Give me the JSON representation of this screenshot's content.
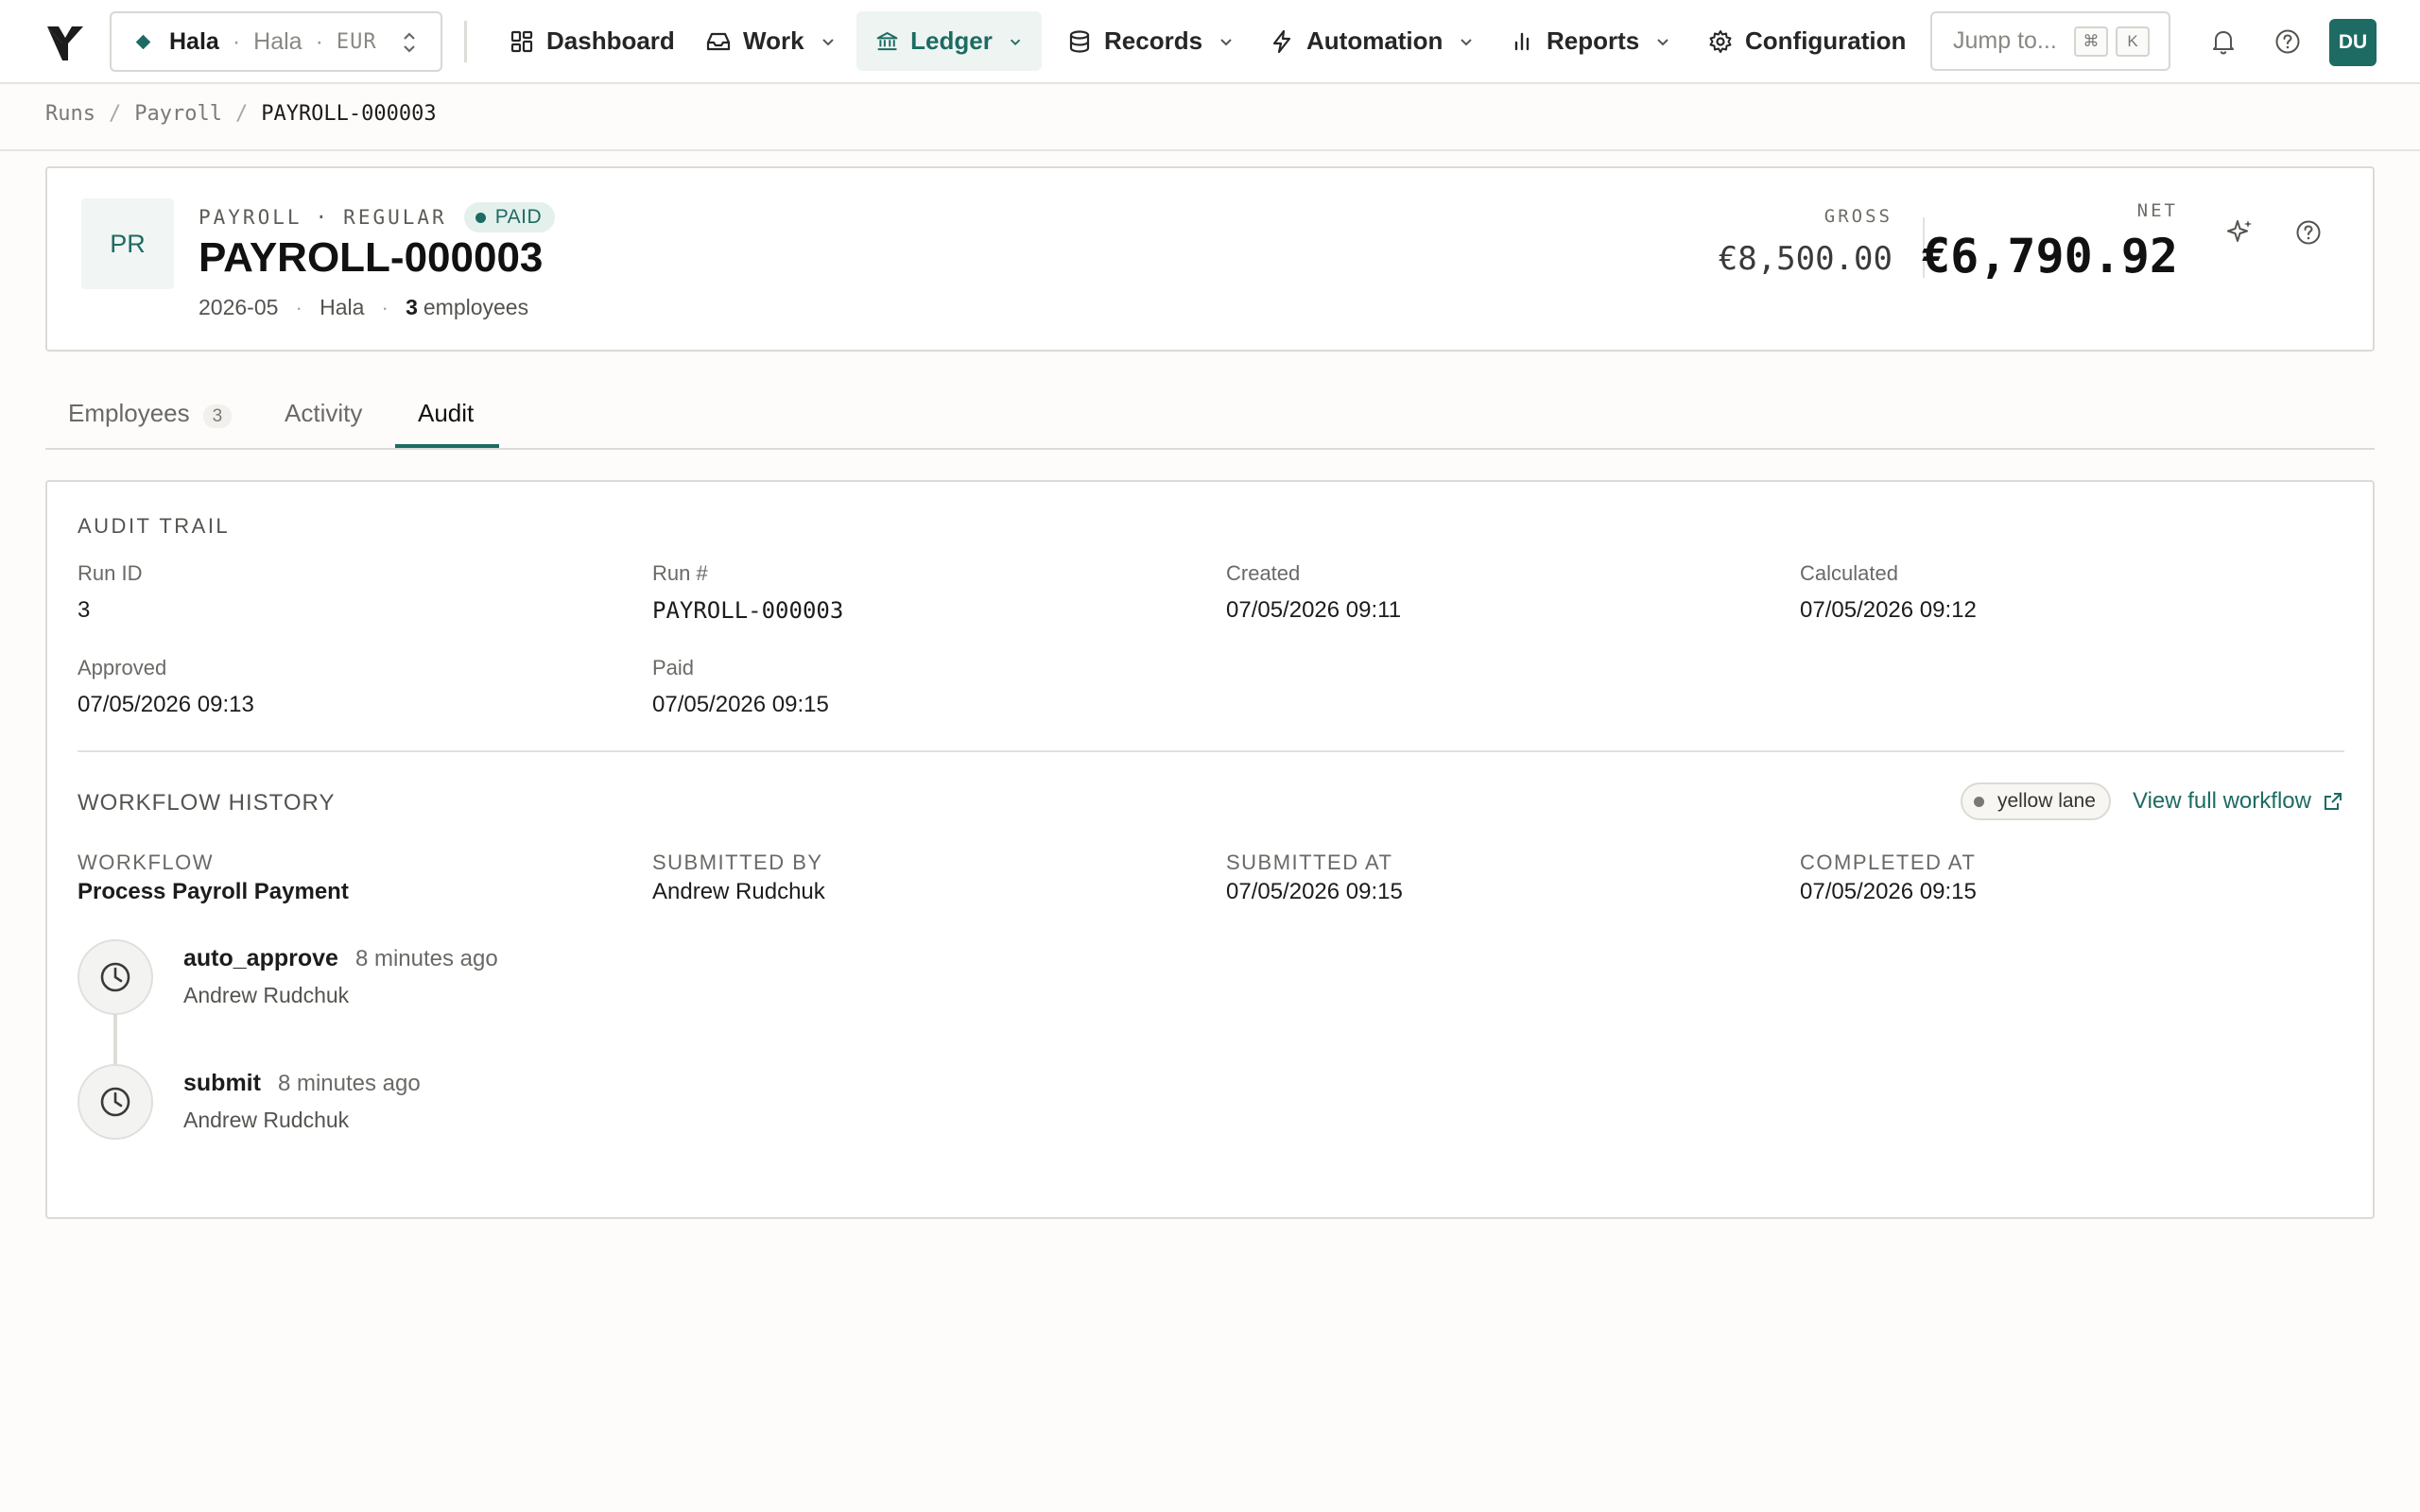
{
  "nav": {
    "org": {
      "name": "Hala",
      "entity": "Hala",
      "currency": "EUR"
    },
    "items": [
      {
        "label": "Dashboard",
        "icon": "grid-icon"
      },
      {
        "label": "Work",
        "icon": "inbox-icon"
      },
      {
        "label": "Ledger",
        "icon": "bank-icon"
      },
      {
        "label": "Records",
        "icon": "database-icon"
      },
      {
        "label": "Automation",
        "icon": "bolt-icon"
      },
      {
        "label": "Reports",
        "icon": "bar-chart-icon"
      },
      {
        "label": "Configuration",
        "icon": "gear-icon"
      }
    ],
    "active_item": "Ledger",
    "jump": {
      "placeholder": "Jump to...",
      "key1": "⌘",
      "key2": "K"
    },
    "avatar": "DU",
    "accent": "#1d6b62"
  },
  "breadcrumb": [
    "Runs",
    "Payroll",
    "PAYROLL-000003"
  ],
  "header": {
    "initials": "PR",
    "type": "PAYROLL",
    "kind": "REGULAR",
    "status": "PAID",
    "title": "PAYROLL-000003",
    "period": "2026-05",
    "entity": "Hala",
    "employee_count": "3",
    "employee_label": "employees",
    "gross_label": "GROSS",
    "gross_value": "€8,500.00",
    "net_label": "NET",
    "net_value": "€6,790.92"
  },
  "tabs": [
    {
      "label": "Employees",
      "count": "3"
    },
    {
      "label": "Activity"
    },
    {
      "label": "Audit"
    }
  ],
  "active_tab": "Audit",
  "audit": {
    "title": "AUDIT TRAIL",
    "fields": [
      {
        "label": "Run ID",
        "value": "3"
      },
      {
        "label": "Run #",
        "value": "PAYROLL-000003"
      },
      {
        "label": "Created",
        "value": "07/05/2026 09:11"
      },
      {
        "label": "Calculated",
        "value": "07/05/2026 09:12"
      },
      {
        "label": "Approved",
        "value": "07/05/2026 09:13"
      },
      {
        "label": "Paid",
        "value": "07/05/2026 09:15"
      }
    ]
  },
  "workflow": {
    "title": "WORKFLOW HISTORY",
    "lane": "yellow lane",
    "view_link": "View full workflow",
    "fields": [
      {
        "label": "WORKFLOW",
        "value": "Process Payroll Payment"
      },
      {
        "label": "SUBMITTED BY",
        "value": "Andrew Rudchuk"
      },
      {
        "label": "SUBMITTED AT",
        "value": "07/05/2026 09:15"
      },
      {
        "label": "COMPLETED AT",
        "value": "07/05/2026 09:15"
      }
    ],
    "events": [
      {
        "action": "auto_approve",
        "time": "8 minutes ago",
        "user": "Andrew Rudchuk",
        "icon": "clock-icon"
      },
      {
        "action": "submit",
        "time": "8 minutes ago",
        "user": "Andrew Rudchuk",
        "icon": "clock-icon"
      }
    ]
  }
}
